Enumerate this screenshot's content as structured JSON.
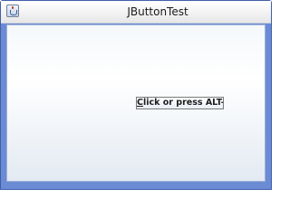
{
  "window": {
    "title": "JButtonTest",
    "icon": "java-cup-icon"
  },
  "button": {
    "mnemonic_char": "C",
    "label_rest": "lick or press ALT-C"
  },
  "colors": {
    "frame_border": "#6b8bd4",
    "content_top": "#ffffff",
    "content_bottom": "#e3eaf2"
  }
}
